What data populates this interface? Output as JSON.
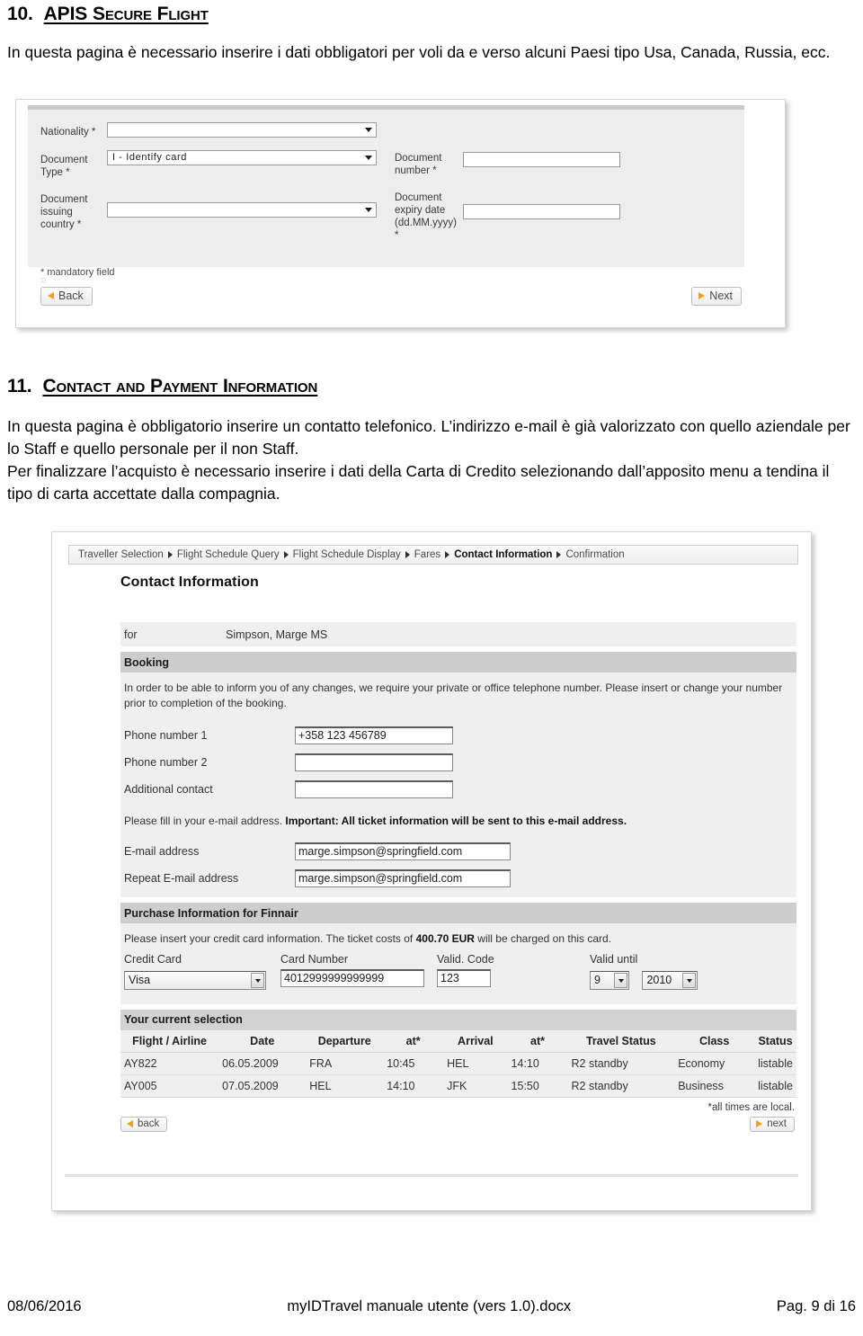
{
  "document": {
    "section10": {
      "number": "10.",
      "title": "APIS Secure Flight",
      "paragraph": "In questa pagina è necessario inserire i dati obbligatori per voli da e verso alcuni Paesi tipo Usa, Canada, Russia, ecc."
    },
    "section11": {
      "number": "11.",
      "title": "Contact and Payment Information",
      "paragraph1": "In questa pagina è obbligatorio inserire un contatto telefonico. L’indirizzo e-mail è già valorizzato con quello aziendale per lo Staff e quello personale per il non Staff.",
      "paragraph2": "Per finalizzare l’acquisto è necessario inserire i dati della Carta di Credito selezionando dall’apposito menu a tendina il tipo di carta accettate dalla compagnia."
    },
    "footer": {
      "date": "08/06/2016",
      "filename": "myIDTravel manuale utente (vers 1.0).docx",
      "page": "Pag. 9 di 16"
    }
  },
  "apis_screenshot": {
    "fields": {
      "nationality_label": "Nationality *",
      "nationality_value": "",
      "document_type_label": "Document Type *",
      "document_type_value": "I - Identify card",
      "document_issuing_country_label": "Document issuing country *",
      "document_issuing_country_value": "",
      "document_number_label": "Document number *",
      "document_number_value": "",
      "document_expiry_label": "Document expiry date (dd.MM.yyyy) *",
      "document_expiry_value": ""
    },
    "mandatory_note": "* mandatory field",
    "back_label": "Back",
    "next_label": "Next"
  },
  "contact_screenshot": {
    "breadcrumb": [
      {
        "label": "Traveller Selection",
        "current": false
      },
      {
        "label": "Flight Schedule Query",
        "current": false
      },
      {
        "label": "Flight Schedule Display",
        "current": false
      },
      {
        "label": "Fares",
        "current": false
      },
      {
        "label": "Contact Information",
        "current": true
      },
      {
        "label": "Confirmation",
        "current": false
      }
    ],
    "page_title": "Contact Information",
    "for_label": "for",
    "for_value": "Simpson, Marge MS",
    "booking_band": "Booking",
    "booking_note": "In order to be able to inform you of any changes, we require your private or office telephone number. Please insert or change your number prior to completion of the booking.",
    "phone1_label": "Phone number 1",
    "phone1_value": "+358 123 456789",
    "phone2_label": "Phone number 2",
    "phone2_value": "",
    "additional_contact_label": "Additional contact",
    "additional_contact_value": "",
    "email_note_plain": "Please fill in your e-mail address. ",
    "email_note_bold": "Important: All ticket information will be sent to this e-mail address.",
    "email_label": "E-mail address",
    "email_value": "marge.simpson@springfield.com",
    "email_repeat_label": "Repeat E-mail address",
    "email_repeat_value": "marge.simpson@springfield.com",
    "purchase_band": "Purchase Information for Finnair",
    "purchase_note_pre": "Please insert your credit card information. The ticket costs of ",
    "purchase_note_amount": "400.70 EUR",
    "purchase_note_post": " will be charged on this card.",
    "credit_card_label": "Credit Card",
    "credit_card_value": "Visa",
    "card_number_label": "Card Number",
    "card_number_value": "4012999999999999",
    "valid_code_label": "Valid. Code",
    "valid_code_value": "123",
    "valid_until_label": "Valid until",
    "valid_until_month": "9",
    "valid_until_year": "2010",
    "selection_band": "Your current selection",
    "table": {
      "headers": [
        "Flight / Airline",
        "Date",
        "Departure",
        "at*",
        "Arrival",
        "at*",
        "Travel Status",
        "Class",
        "Status"
      ],
      "rows": [
        [
          "AY822",
          "06.05.2009",
          "FRA",
          "10:45",
          "HEL",
          "14:10",
          "R2 standby",
          "Economy",
          "listable"
        ],
        [
          "AY005",
          "07.05.2009",
          "HEL",
          "14:10",
          "JFK",
          "15:50",
          "R2 standby",
          "Business",
          "listable"
        ]
      ]
    },
    "all_times_note": "*all times are local.",
    "back_label": "back",
    "next_label": "next"
  }
}
